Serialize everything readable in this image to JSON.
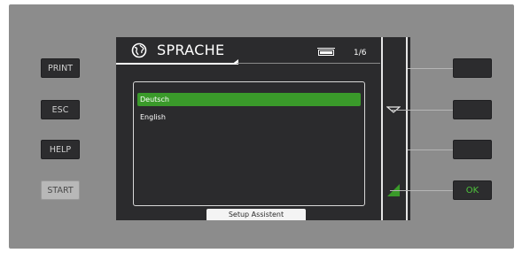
{
  "left_buttons": [
    {
      "label": "PRINT"
    },
    {
      "label": "ESC"
    },
    {
      "label": "HELP"
    },
    {
      "label": "START"
    }
  ],
  "screen": {
    "title": "SPRACHE",
    "title_icon": "globe-icon",
    "status_icon": "battery-icon",
    "page_indicator": "1/6",
    "options": [
      {
        "label": "Deutsch",
        "selected": true
      },
      {
        "label": "English",
        "selected": false
      }
    ],
    "status_bar": "Setup Assistent"
  },
  "soft_indicators": [
    {
      "icon": "down-triangle-icon"
    },
    {
      "icon": "green-ramp-icon"
    }
  ],
  "right_buttons": [
    {
      "label": ""
    },
    {
      "label": ""
    },
    {
      "label": ""
    },
    {
      "label": "OK"
    }
  ],
  "colors": {
    "panel": "#8c8c8c",
    "screen": "#2b2b2d",
    "selected": "#3a9a2a",
    "ok_text": "#4fc43c"
  }
}
